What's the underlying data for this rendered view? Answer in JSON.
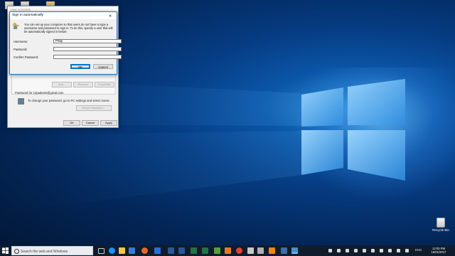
{
  "user_accounts": {
    "title": "User Accounts",
    "buttons": {
      "add": "Add...",
      "remove": "Remove",
      "properties": "Properties"
    },
    "password_for": "Password for 12padams@gmail.com",
    "change_password_text": "To change your password, go to PC settings and select Users.",
    "reset_password": "Reset Password...",
    "ok": "OK",
    "cancel": "Cancel",
    "apply": "Apply"
  },
  "dialog": {
    "title": "Sign in automatically",
    "description": "You can set up your computer so that users do not have to type a username and password to sign in. To do this, specify a user that will be automatically signed in below:",
    "username_label": "Username:",
    "username_value": "Philip",
    "password_label": "Password:",
    "password_value": "",
    "confirm_label": "Confirm Password:",
    "confirm_value": "",
    "ok": "OK",
    "cancel": "Cancel",
    "close_glyph": "✕"
  },
  "desktop": {
    "recycle_bin": "Recycle Bin"
  },
  "taskbar": {
    "search_placeholder": "Search the web and Windows",
    "language": "ENG",
    "time": "12:03 PM",
    "date": "15/01/2017"
  },
  "colors": {
    "accent": "#0078d7",
    "taskbar": "#101c2c",
    "dialog_bg": "#f0f0f0"
  }
}
